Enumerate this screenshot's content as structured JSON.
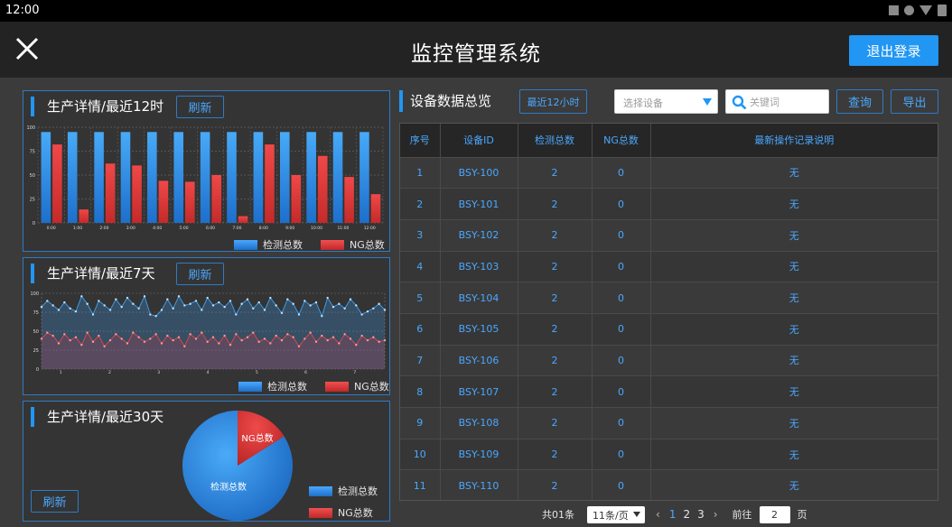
{
  "statusbar": {
    "time": "12:00"
  },
  "header": {
    "title": "监控管理系统",
    "logout_label": "退出登录"
  },
  "colors": {
    "accent": "#2196f3",
    "total_series": "#3ea2f5",
    "ng_series": "#e64545"
  },
  "panels": {
    "hourly": {
      "title": "生产详情/最近12时",
      "refresh_label": "刷新"
    },
    "weekly": {
      "title": "生产详情/最近7天",
      "refresh_label": "刷新"
    },
    "monthly": {
      "title": "生产详情/最近30天",
      "refresh_label": "刷新"
    }
  },
  "legend": {
    "total": "检测总数",
    "ng": "NG总数"
  },
  "right": {
    "title": "设备数据总览",
    "range_button": "最近12小时",
    "device_select_placeholder": "选择设备",
    "search_placeholder": "关键词",
    "query_label": "查询",
    "export_label": "导出"
  },
  "table": {
    "columns": [
      "序号",
      "设备ID",
      "检测总数",
      "NG总数",
      "最新操作记录说明"
    ],
    "rows": [
      [
        "1",
        "BSY-100",
        "2",
        "0",
        "无"
      ],
      [
        "2",
        "BSY-101",
        "2",
        "0",
        "无"
      ],
      [
        "3",
        "BSY-102",
        "2",
        "0",
        "无"
      ],
      [
        "4",
        "BSY-103",
        "2",
        "0",
        "无"
      ],
      [
        "5",
        "BSY-104",
        "2",
        "0",
        "无"
      ],
      [
        "6",
        "BSY-105",
        "2",
        "0",
        "无"
      ],
      [
        "7",
        "BSY-106",
        "2",
        "0",
        "无"
      ],
      [
        "8",
        "BSY-107",
        "2",
        "0",
        "无"
      ],
      [
        "9",
        "BSY-108",
        "2",
        "0",
        "无"
      ],
      [
        "10",
        "BSY-109",
        "2",
        "0",
        "无"
      ],
      [
        "11",
        "BSY-110",
        "2",
        "0",
        "无"
      ]
    ]
  },
  "pagination": {
    "total": "共01条",
    "page_size": "11条/页",
    "prev": "‹",
    "next": "›",
    "pages": [
      "1",
      "2",
      "3"
    ],
    "current": "1",
    "goto_label": "前往",
    "goto_value": "2",
    "page_unit": "页"
  },
  "chart_data": [
    {
      "type": "bar",
      "categories": [
        "0:00",
        "1:00",
        "2:00",
        "3:00",
        "4:00",
        "5:00",
        "6:00",
        "7:00",
        "8:00",
        "9:00",
        "10:00",
        "11:00",
        "12:00"
      ],
      "series": [
        {
          "name": "检测总数",
          "values": [
            95,
            95,
            95,
            95,
            95,
            95,
            95,
            95,
            95,
            95,
            95,
            95,
            95
          ]
        },
        {
          "name": "NG总数",
          "values": [
            82,
            14,
            62,
            60,
            44,
            43,
            50,
            7,
            82,
            50,
            70,
            48,
            30
          ]
        }
      ],
      "ylim": [
        0,
        100
      ],
      "yticks": [
        "0",
        "25",
        "50",
        "75",
        "100"
      ],
      "grid": true,
      "legend": "bottom-right"
    },
    {
      "type": "area",
      "xticks": [
        "1",
        "2",
        "3",
        "4",
        "5",
        "6",
        "7"
      ],
      "series": [
        {
          "name": "检测总数",
          "values": [
            82,
            90,
            84,
            78,
            88,
            80,
            76,
            96,
            86,
            72,
            90,
            84,
            78,
            92,
            82,
            94,
            86,
            80,
            96,
            72,
            70,
            78,
            92,
            80,
            96,
            84,
            86,
            90,
            78,
            94,
            84,
            88,
            82,
            90,
            72,
            86,
            92,
            80,
            88,
            78,
            94,
            84,
            74,
            92,
            86,
            72,
            90,
            84,
            88,
            70,
            94,
            82,
            86,
            80,
            92,
            84,
            72,
            76,
            80,
            86,
            78
          ]
        },
        {
          "name": "NG总数",
          "values": [
            40,
            48,
            44,
            34,
            46,
            38,
            42,
            32,
            48,
            36,
            44,
            30,
            38,
            46,
            40,
            34,
            48,
            42,
            36,
            40,
            46,
            34,
            44,
            38,
            42,
            30,
            46,
            40,
            48,
            36,
            42,
            34,
            44,
            32,
            46,
            38,
            42,
            48,
            36,
            40,
            34,
            44,
            38,
            46,
            42,
            30,
            40,
            48,
            36,
            44,
            38,
            42,
            34,
            46,
            40,
            32,
            44,
            38,
            42,
            36,
            38
          ]
        }
      ],
      "ylim": [
        0,
        100
      ],
      "yticks": [
        "0",
        "25",
        "50",
        "75",
        "100"
      ],
      "grid": true,
      "legend": "bottom-right"
    },
    {
      "type": "pie",
      "slices": [
        {
          "name": "检测总数",
          "value": 84
        },
        {
          "name": "NG总数",
          "value": 16
        }
      ],
      "legend": "bottom-right"
    }
  ]
}
